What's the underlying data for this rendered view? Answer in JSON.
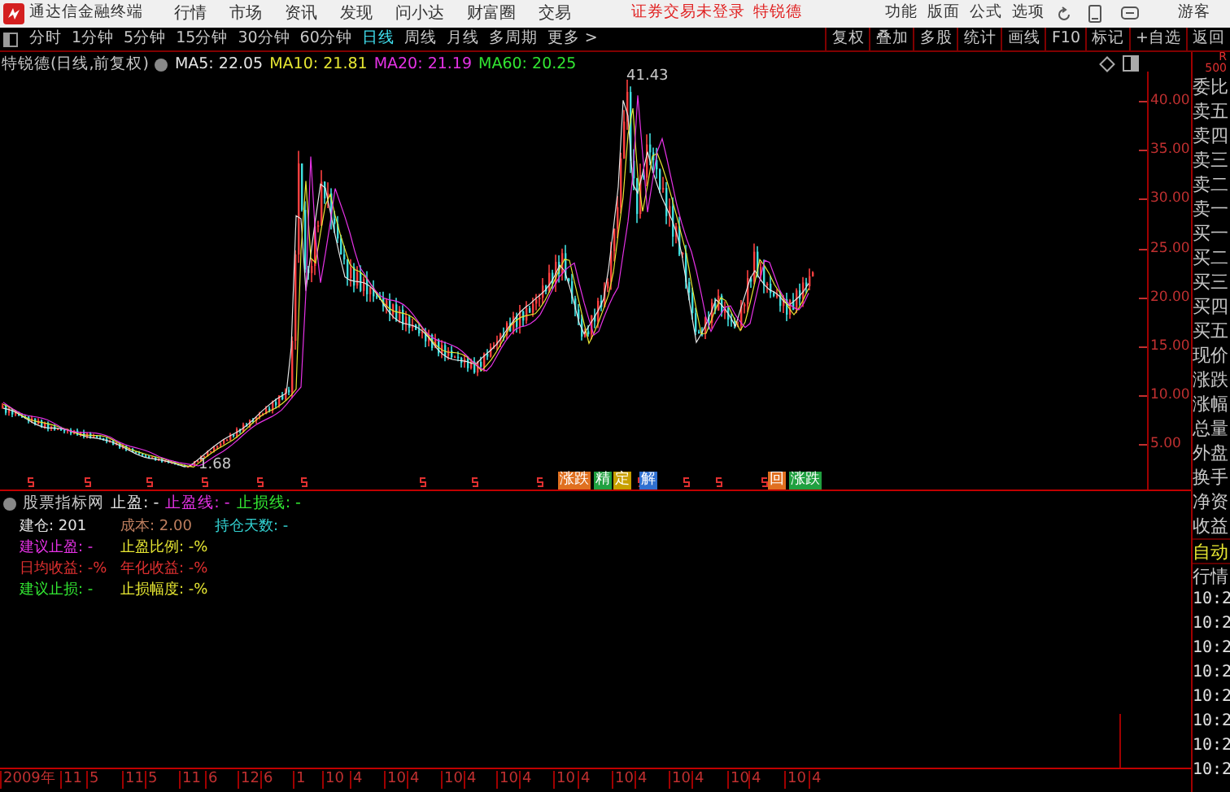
{
  "app": {
    "title": "通达信金融终端"
  },
  "menu": [
    "行情",
    "市场",
    "资讯",
    "发现",
    "问小达",
    "财富圈",
    "交易"
  ],
  "login_status": "证券交易未登录",
  "stock_link": "特锐德",
  "top_right_menu": [
    "功能",
    "版面",
    "公式",
    "选项"
  ],
  "user": "游客",
  "periods": [
    {
      "label": "分时",
      "selected": false
    },
    {
      "label": "1分钟",
      "selected": false
    },
    {
      "label": "5分钟",
      "selected": false
    },
    {
      "label": "15分钟",
      "selected": false
    },
    {
      "label": "30分钟",
      "selected": false
    },
    {
      "label": "60分钟",
      "selected": false
    },
    {
      "label": "日线",
      "selected": true
    },
    {
      "label": "周线",
      "selected": false
    },
    {
      "label": "月线",
      "selected": false
    },
    {
      "label": "多周期",
      "selected": false
    },
    {
      "label": "更多 >",
      "selected": false
    }
  ],
  "tools": [
    "复权",
    "叠加",
    "多股",
    "统计",
    "画线",
    "F10",
    "标记",
    "+自选",
    "返回"
  ],
  "chart_header": {
    "title": "特锐德(日线,前复权)",
    "ma": [
      {
        "label": "MA5: 22.05",
        "color": "#e5e5e5"
      },
      {
        "label": "MA10: 21.81",
        "color": "#e6e632"
      },
      {
        "label": "MA20: 21.19",
        "color": "#e632e6"
      },
      {
        "label": "MA60: 20.25",
        "color": "#32e632"
      }
    ]
  },
  "chart_labels": {
    "high": "41.43",
    "low": "1.68"
  },
  "price_axis": [
    "40.00",
    "35.00",
    "30.00",
    "25.00",
    "20.00",
    "15.00",
    "10.00",
    "5.00"
  ],
  "event_tags": [
    {
      "label": "涨跌",
      "color": "#e07020"
    },
    {
      "label": "精",
      "color": "#20a040"
    },
    {
      "label": "定",
      "color": "#c8a000"
    },
    {
      "label": "解",
      "color": "#3070d0"
    },
    {
      "label": "回",
      "color": "#e07020"
    },
    {
      "label": "涨跌",
      "color": "#20a040"
    }
  ],
  "indicator": {
    "title": "股票指标网",
    "header": [
      {
        "label": "止盈: -",
        "color": "#e5e5e5"
      },
      {
        "label": "止盈线: -",
        "color": "#e632e6"
      },
      {
        "label": "止损线: -",
        "color": "#32e632"
      }
    ],
    "fields": [
      {
        "label": "建仓: 201",
        "color": "#e5e5e5"
      },
      {
        "label": "成本: 2.00",
        "color": "#c08060"
      },
      {
        "label": "持仓天数: -",
        "color": "#32d0d0"
      },
      {
        "label": "建议止盈: -",
        "color": "#e632e6"
      },
      {
        "label": "止盈比例: -%",
        "color": "#e6e632"
      },
      {
        "label": "日均收益: -%",
        "color": "#e03030"
      },
      {
        "label": "年化收益: -%",
        "color": "#e03030"
      },
      {
        "label": "建议止损: -",
        "color": "#32e632"
      },
      {
        "label": "止损幅度: -%",
        "color": "#e6e632"
      }
    ]
  },
  "date_axis": [
    "2009年",
    "11",
    "5",
    "11",
    "5",
    "11",
    "6",
    "12",
    "6",
    "1",
    "10",
    "4",
    "10",
    "4",
    "10",
    "4",
    "10",
    "4",
    "10",
    "4",
    "10",
    "4",
    "10",
    "4",
    "10",
    "4",
    "10",
    "4"
  ],
  "quote_panel": {
    "badge": [
      "R",
      "500"
    ],
    "labels": [
      "委比",
      "卖五",
      "卖四",
      "卖三",
      "卖二",
      "卖一",
      "买一",
      "买二",
      "买三",
      "买四",
      "买五",
      "现价",
      "涨跌",
      "涨幅",
      "总量",
      "外盘",
      "换手",
      "净资",
      "收益"
    ],
    "mode_tabs": [
      {
        "label": "自动",
        "selected": true
      },
      {
        "label": "行情",
        "selected": false
      }
    ],
    "times": [
      "10:2",
      "10:2",
      "10:2",
      "10:2",
      "10:2",
      "10:2",
      "10:2",
      "10:2"
    ]
  }
}
